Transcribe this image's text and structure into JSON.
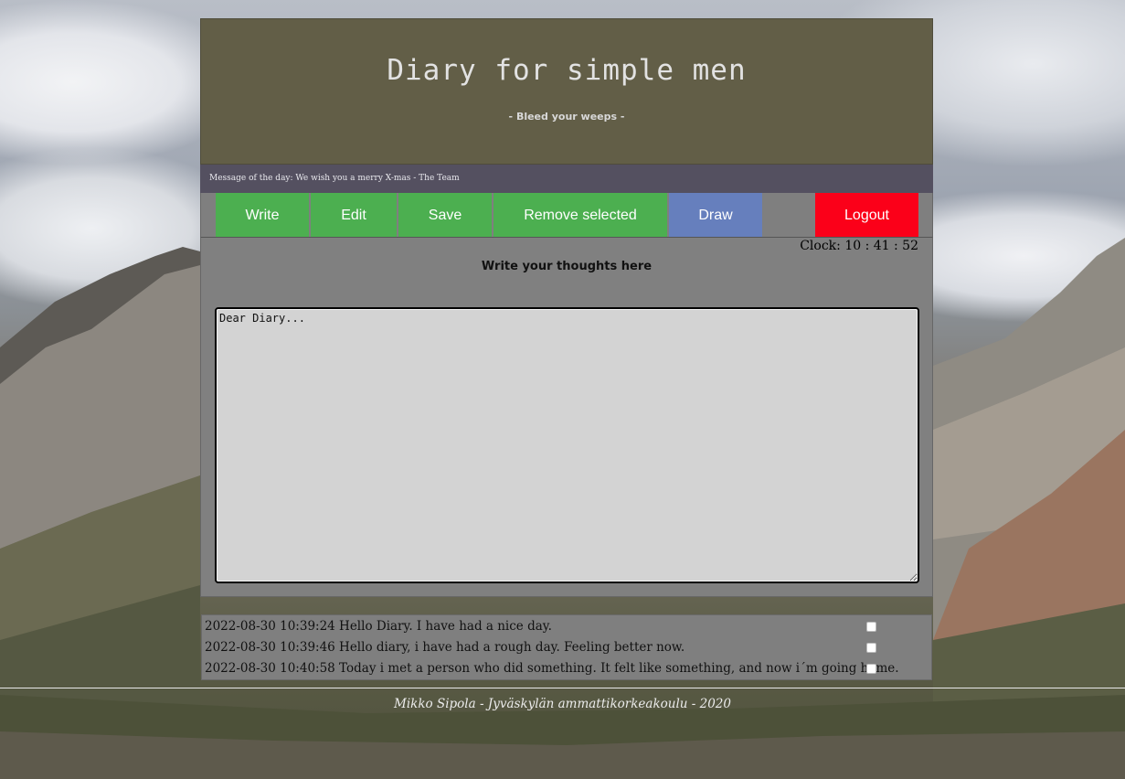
{
  "header": {
    "title": "Diary for simple men",
    "tagline": "- Bleed your weeps -"
  },
  "motd": "Message of the day: We wish you a merry X-mas - The Team",
  "toolbar": {
    "write": "Write",
    "edit": "Edit",
    "save": "Save",
    "remove": "Remove selected",
    "draw": "Draw",
    "logout": "Logout"
  },
  "clock": "Clock: 10 : 41 : 52",
  "editor": {
    "title": "Write your thoughts here",
    "value": "Dear Diary..."
  },
  "entries": [
    {
      "text": "2022-08-30 10:39:24 Hello Diary. I have had a nice day.",
      "checked": false
    },
    {
      "text": "2022-08-30 10:39:46 Hello diary, i have had a rough day. Feeling better now.",
      "checked": false
    },
    {
      "text": "2022-08-30 10:40:58 Today i met a person who did something. It felt like something, and now i´m going home.",
      "checked": false
    }
  ],
  "footer": "Mikko Sipola - Jyväskylän ammattikorkeakoulu - 2020",
  "colors": {
    "header_bg": "#625e47",
    "motd_bg": "#545060",
    "button_green": "#4caf50",
    "button_blue": "#667fbd",
    "button_red": "#fb0019",
    "panel_bg": "#808080"
  }
}
